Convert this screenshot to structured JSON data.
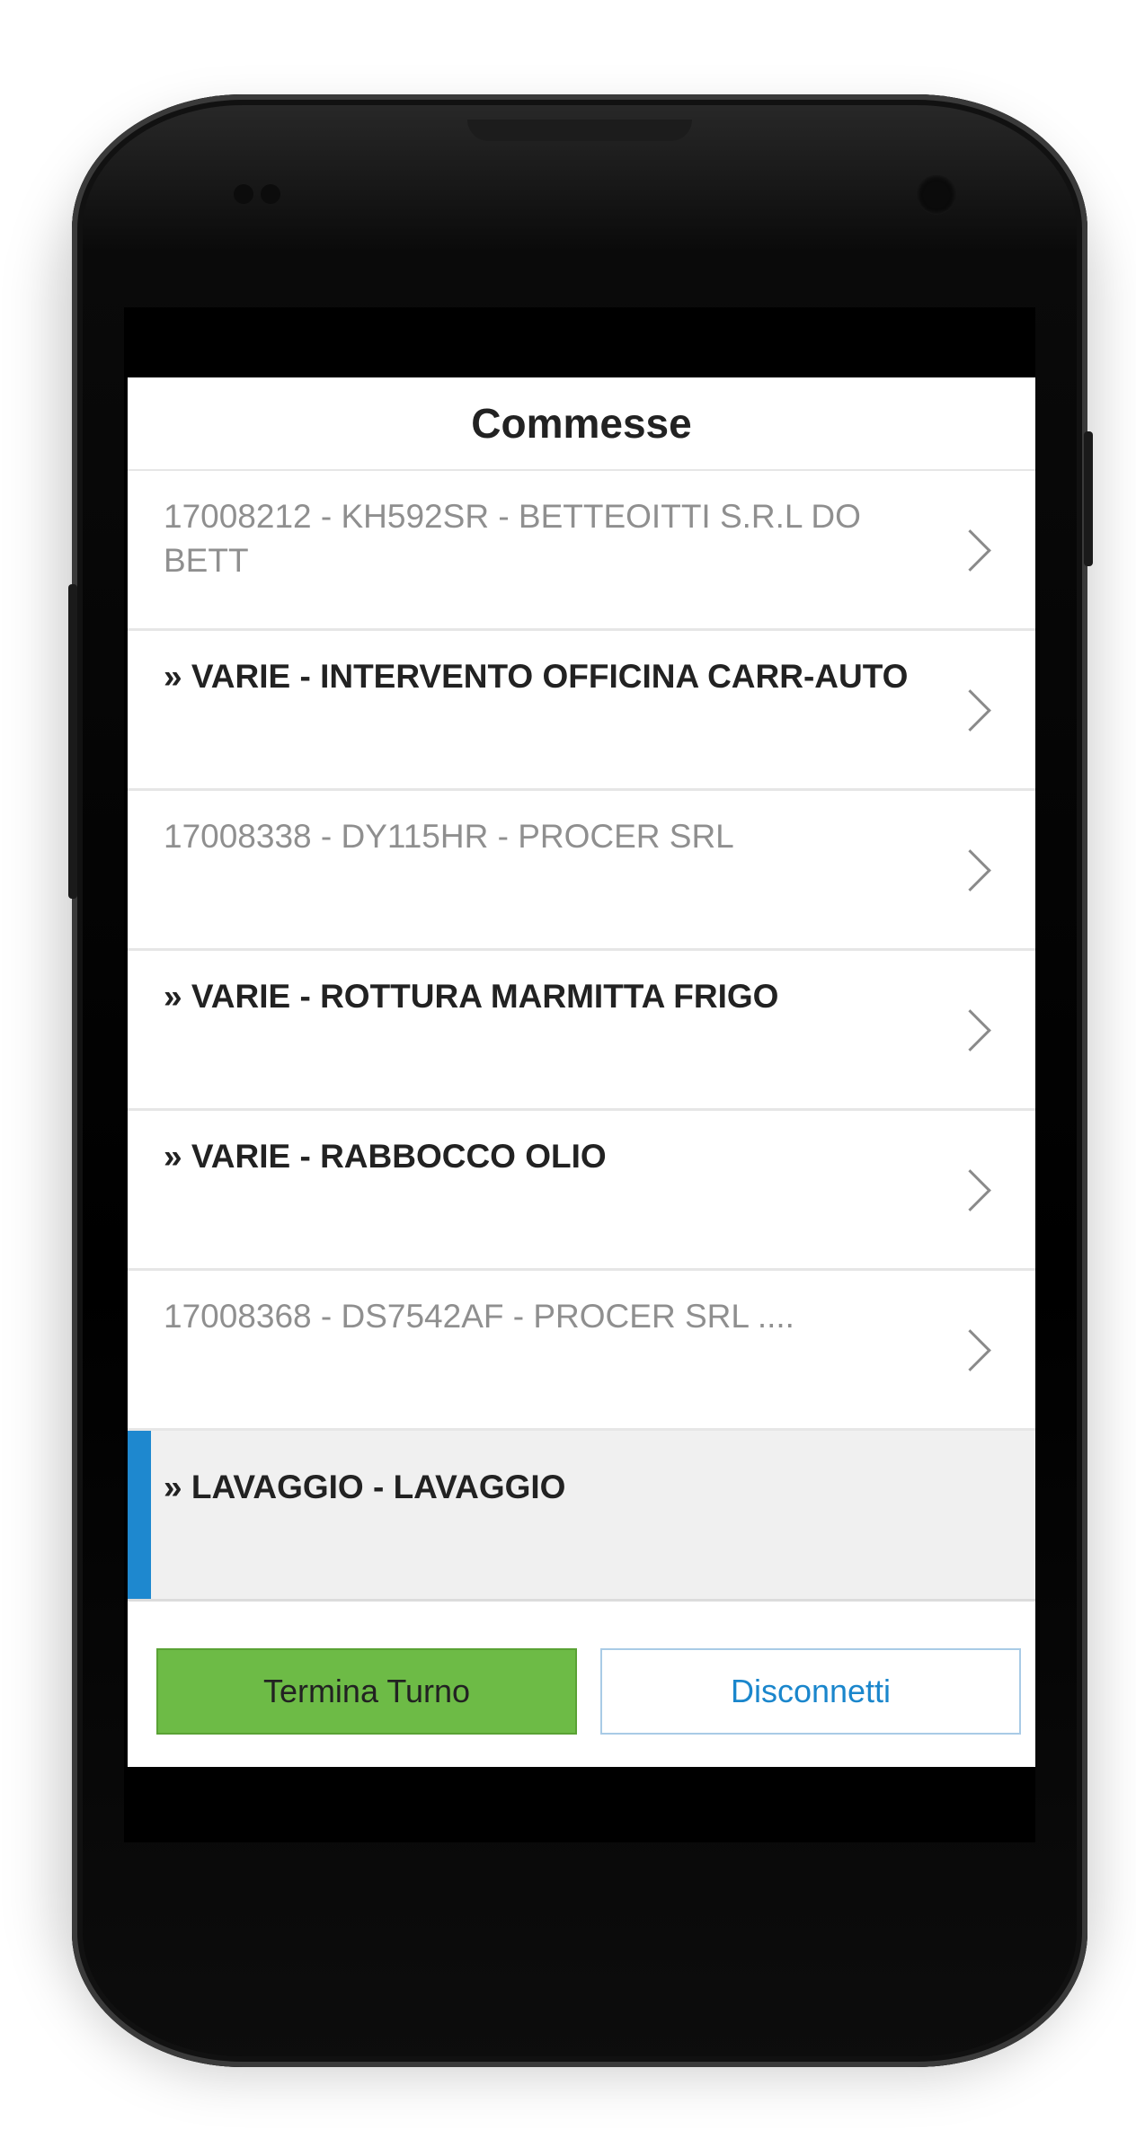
{
  "dialog": {
    "title": "Commesse",
    "items": [
      {
        "label": "17008212 - KH592SR - BETTEOITTI S.R.L DO BETT",
        "style": "inactive"
      },
      {
        "label": "» VARIE - INTERVENTO OFFICINA CARR-AUTO",
        "style": "active"
      },
      {
        "label": "17008338 - DY115HR - PROCER SRL",
        "style": "inactive"
      },
      {
        "label": "» VARIE - ROTTURA MARMITTA FRIGO",
        "style": "active"
      },
      {
        "label": "» VARIE - RABBOCCO OLIO",
        "style": "active"
      },
      {
        "label": "17008368 - DS7542AF - PROCER SRL ....",
        "style": "inactive"
      },
      {
        "label": "» LAVAGGIO - LAVAGGIO",
        "style": "selected"
      }
    ],
    "buttons": {
      "end_shift": "Termina Turno",
      "disconnect": "Disconnetti"
    }
  },
  "colors": {
    "accent_green": "#6dbb46",
    "accent_blue": "#1e88cf",
    "inactive_text": "#8f8f8f"
  },
  "icons": {
    "row_arrow": "chevron-right-icon"
  }
}
